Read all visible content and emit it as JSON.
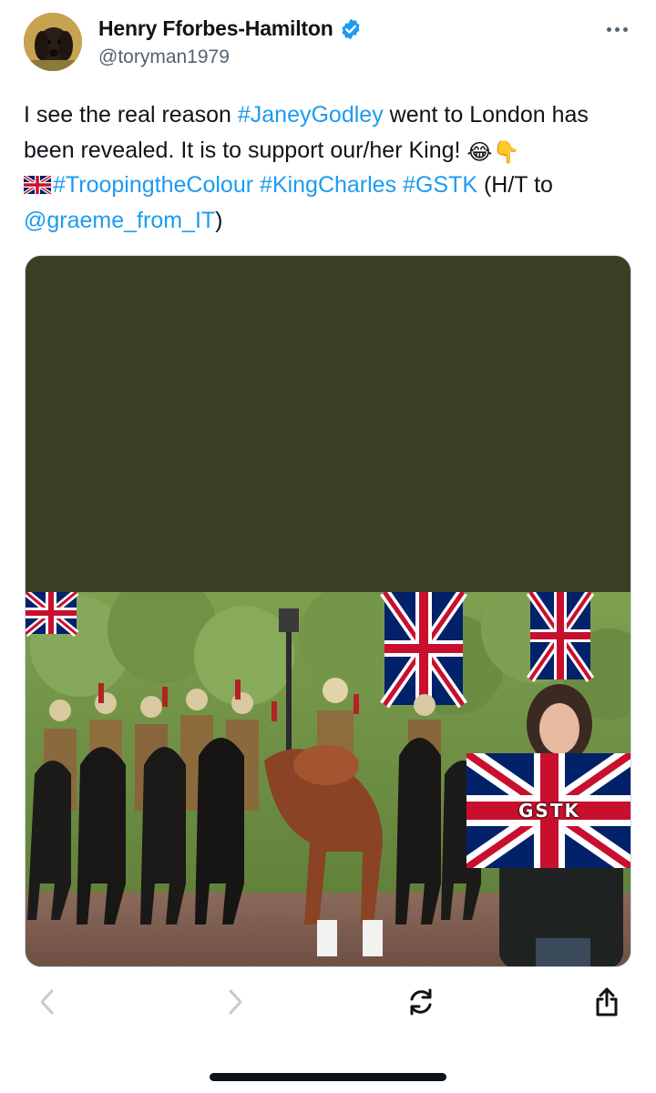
{
  "author": {
    "display_name": "Henry Fforbes-Hamilton",
    "handle": "@toryman1979",
    "verified": true,
    "avatar": "dog-avatar"
  },
  "tweet": {
    "text_intro": "I see the real reason ",
    "hashtag_janey": "#JaneyGodley",
    "text_mid": " went to London has been revealed. It is to support our/her King! ",
    "emoji_laugh": "😂",
    "emoji_point": "👇",
    "hashtag_trooping": "#TroopingtheColour",
    "hashtag_king": "#KingCharles",
    "hashtag_gstk": "#GSTK",
    "text_ht": " (H/T to ",
    "mention": "@graeme_from_IT",
    "text_close": ")"
  },
  "media": {
    "overlay_flag_text": "GSTK"
  },
  "icons": {
    "more": "more-horizontal-icon",
    "back": "chevron-left-icon",
    "forward": "chevron-right-icon",
    "refresh": "refresh-icon",
    "share": "share-icon"
  },
  "colors": {
    "link": "#1d9bf0",
    "verified_badge": "#1d9bf0",
    "secondary_text": "#536471",
    "media_top": "#3b4024"
  }
}
